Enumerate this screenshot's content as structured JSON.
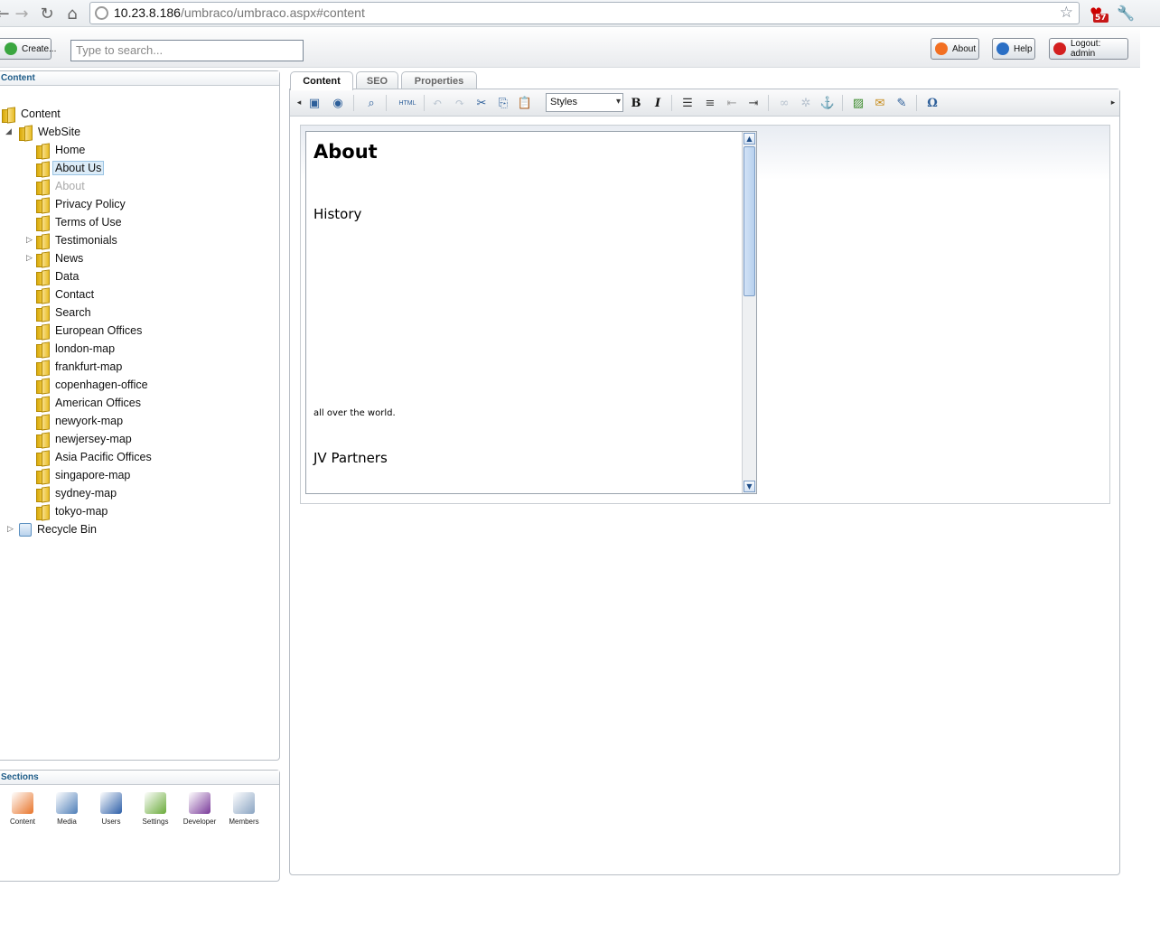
{
  "browser": {
    "url_host": "10.23.8.186",
    "url_path": "/umbraco/umbraco.aspx#content",
    "extension_badge": "57"
  },
  "header": {
    "create_label": "Create...",
    "search_placeholder": "Type to search...",
    "about_label": "About",
    "help_label": "Help",
    "logout_label": "Logout: admin"
  },
  "tree": {
    "title": "Content",
    "root": "Content",
    "website": "WebSite",
    "items": [
      {
        "label": "Home"
      },
      {
        "label": "About Us",
        "selected": true
      },
      {
        "label": "About",
        "muted": true
      },
      {
        "label": "Privacy Policy"
      },
      {
        "label": "Terms of Use"
      },
      {
        "label": "Testimonials",
        "expandable": true
      },
      {
        "label": "News",
        "expandable": true
      },
      {
        "label": "Data"
      },
      {
        "label": "Contact"
      },
      {
        "label": "Search"
      },
      {
        "label": "European Offices"
      },
      {
        "label": "london-map"
      },
      {
        "label": "frankfurt-map"
      },
      {
        "label": "copenhagen-office"
      },
      {
        "label": "American Offices"
      },
      {
        "label": "newyork-map"
      },
      {
        "label": "newjersey-map"
      },
      {
        "label": "Asia Pacific Offices"
      },
      {
        "label": "singapore-map"
      },
      {
        "label": "sydney-map"
      },
      {
        "label": "tokyo-map"
      }
    ],
    "recycle_bin": "Recycle Bin"
  },
  "sections": {
    "title": "Sections",
    "items": [
      {
        "label": "Content",
        "color": "#e8742a"
      },
      {
        "label": "Media",
        "color": "#4f7fb8"
      },
      {
        "label": "Users",
        "color": "#2d5fa8"
      },
      {
        "label": "Settings",
        "color": "#6aab3a"
      },
      {
        "label": "Developer",
        "color": "#7a3a9a"
      },
      {
        "label": "Members",
        "color": "#8aa4c2"
      }
    ]
  },
  "tabs": {
    "content": "Content",
    "seo": "SEO",
    "properties": "Properties"
  },
  "toolbar": {
    "styles_label": "Styles",
    "html_label": "HTML",
    "bold_label": "B",
    "italic_label": "I",
    "omega_label": "Ω"
  },
  "document": {
    "heading": "About",
    "subheading_1": "History",
    "paragraph": "all over the world.",
    "subheading_2": "JV Partners"
  }
}
